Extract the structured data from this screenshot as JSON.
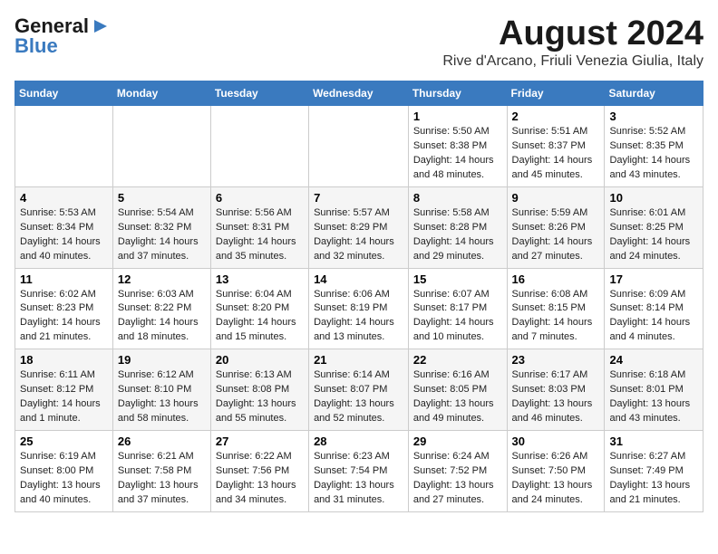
{
  "logo": {
    "line1": "General",
    "line2": "Blue"
  },
  "title": "August 2024",
  "subtitle": "Rive d'Arcano, Friuli Venezia Giulia, Italy",
  "headers": [
    "Sunday",
    "Monday",
    "Tuesday",
    "Wednesday",
    "Thursday",
    "Friday",
    "Saturday"
  ],
  "weeks": [
    [
      {
        "day": "",
        "info": ""
      },
      {
        "day": "",
        "info": ""
      },
      {
        "day": "",
        "info": ""
      },
      {
        "day": "",
        "info": ""
      },
      {
        "day": "1",
        "info": "Sunrise: 5:50 AM\nSunset: 8:38 PM\nDaylight: 14 hours and 48 minutes."
      },
      {
        "day": "2",
        "info": "Sunrise: 5:51 AM\nSunset: 8:37 PM\nDaylight: 14 hours and 45 minutes."
      },
      {
        "day": "3",
        "info": "Sunrise: 5:52 AM\nSunset: 8:35 PM\nDaylight: 14 hours and 43 minutes."
      }
    ],
    [
      {
        "day": "4",
        "info": "Sunrise: 5:53 AM\nSunset: 8:34 PM\nDaylight: 14 hours and 40 minutes."
      },
      {
        "day": "5",
        "info": "Sunrise: 5:54 AM\nSunset: 8:32 PM\nDaylight: 14 hours and 37 minutes."
      },
      {
        "day": "6",
        "info": "Sunrise: 5:56 AM\nSunset: 8:31 PM\nDaylight: 14 hours and 35 minutes."
      },
      {
        "day": "7",
        "info": "Sunrise: 5:57 AM\nSunset: 8:29 PM\nDaylight: 14 hours and 32 minutes."
      },
      {
        "day": "8",
        "info": "Sunrise: 5:58 AM\nSunset: 8:28 PM\nDaylight: 14 hours and 29 minutes."
      },
      {
        "day": "9",
        "info": "Sunrise: 5:59 AM\nSunset: 8:26 PM\nDaylight: 14 hours and 27 minutes."
      },
      {
        "day": "10",
        "info": "Sunrise: 6:01 AM\nSunset: 8:25 PM\nDaylight: 14 hours and 24 minutes."
      }
    ],
    [
      {
        "day": "11",
        "info": "Sunrise: 6:02 AM\nSunset: 8:23 PM\nDaylight: 14 hours and 21 minutes."
      },
      {
        "day": "12",
        "info": "Sunrise: 6:03 AM\nSunset: 8:22 PM\nDaylight: 14 hours and 18 minutes."
      },
      {
        "day": "13",
        "info": "Sunrise: 6:04 AM\nSunset: 8:20 PM\nDaylight: 14 hours and 15 minutes."
      },
      {
        "day": "14",
        "info": "Sunrise: 6:06 AM\nSunset: 8:19 PM\nDaylight: 14 hours and 13 minutes."
      },
      {
        "day": "15",
        "info": "Sunrise: 6:07 AM\nSunset: 8:17 PM\nDaylight: 14 hours and 10 minutes."
      },
      {
        "day": "16",
        "info": "Sunrise: 6:08 AM\nSunset: 8:15 PM\nDaylight: 14 hours and 7 minutes."
      },
      {
        "day": "17",
        "info": "Sunrise: 6:09 AM\nSunset: 8:14 PM\nDaylight: 14 hours and 4 minutes."
      }
    ],
    [
      {
        "day": "18",
        "info": "Sunrise: 6:11 AM\nSunset: 8:12 PM\nDaylight: 14 hours and 1 minute."
      },
      {
        "day": "19",
        "info": "Sunrise: 6:12 AM\nSunset: 8:10 PM\nDaylight: 13 hours and 58 minutes."
      },
      {
        "day": "20",
        "info": "Sunrise: 6:13 AM\nSunset: 8:08 PM\nDaylight: 13 hours and 55 minutes."
      },
      {
        "day": "21",
        "info": "Sunrise: 6:14 AM\nSunset: 8:07 PM\nDaylight: 13 hours and 52 minutes."
      },
      {
        "day": "22",
        "info": "Sunrise: 6:16 AM\nSunset: 8:05 PM\nDaylight: 13 hours and 49 minutes."
      },
      {
        "day": "23",
        "info": "Sunrise: 6:17 AM\nSunset: 8:03 PM\nDaylight: 13 hours and 46 minutes."
      },
      {
        "day": "24",
        "info": "Sunrise: 6:18 AM\nSunset: 8:01 PM\nDaylight: 13 hours and 43 minutes."
      }
    ],
    [
      {
        "day": "25",
        "info": "Sunrise: 6:19 AM\nSunset: 8:00 PM\nDaylight: 13 hours and 40 minutes."
      },
      {
        "day": "26",
        "info": "Sunrise: 6:21 AM\nSunset: 7:58 PM\nDaylight: 13 hours and 37 minutes."
      },
      {
        "day": "27",
        "info": "Sunrise: 6:22 AM\nSunset: 7:56 PM\nDaylight: 13 hours and 34 minutes."
      },
      {
        "day": "28",
        "info": "Sunrise: 6:23 AM\nSunset: 7:54 PM\nDaylight: 13 hours and 31 minutes."
      },
      {
        "day": "29",
        "info": "Sunrise: 6:24 AM\nSunset: 7:52 PM\nDaylight: 13 hours and 27 minutes."
      },
      {
        "day": "30",
        "info": "Sunrise: 6:26 AM\nSunset: 7:50 PM\nDaylight: 13 hours and 24 minutes."
      },
      {
        "day": "31",
        "info": "Sunrise: 6:27 AM\nSunset: 7:49 PM\nDaylight: 13 hours and 21 minutes."
      }
    ]
  ]
}
